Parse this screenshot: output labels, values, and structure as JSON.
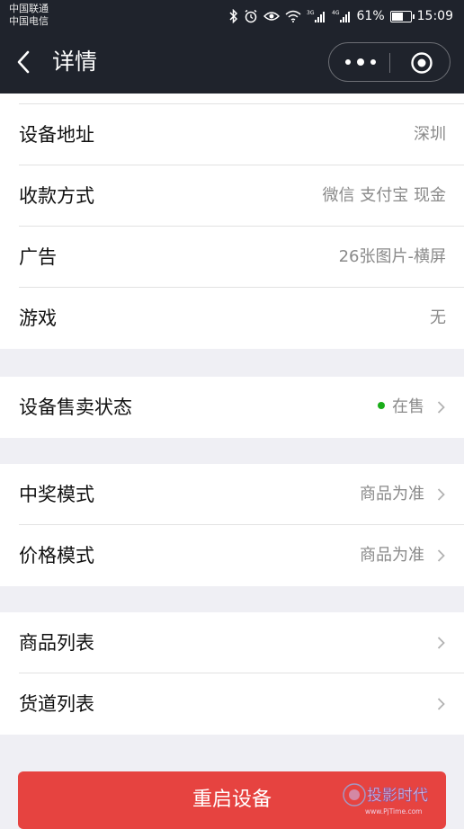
{
  "status_bar": {
    "carrier_1": "中国联通",
    "carrier_2": "中国电信",
    "battery": "61%",
    "time": "15:09",
    "icons": [
      "bluetooth-icon",
      "alarm-icon",
      "eye-icon",
      "wifi-icon",
      "signal-3g-icon",
      "signal-4g-icon",
      "battery-icon"
    ]
  },
  "header": {
    "title": "详情",
    "back_icon": "chevron-left-icon",
    "more_icon": "more-dots-icon",
    "close_icon": "target-circle-icon"
  },
  "info_rows": [
    {
      "label": "设备地址",
      "value": "深圳"
    },
    {
      "label": "收款方式",
      "value": "微信 支付宝 现金"
    },
    {
      "label": "广告",
      "value": "26张图片-横屏"
    },
    {
      "label": "游戏",
      "value": "无"
    }
  ],
  "sale_status": {
    "label": "设备售卖状态",
    "value": "在售",
    "dot_color": "#1aad19"
  },
  "mode_rows": [
    {
      "label": "中奖模式",
      "value": "商品为准"
    },
    {
      "label": "价格模式",
      "value": "商品为准"
    }
  ],
  "list_rows": [
    {
      "label": "商品列表"
    },
    {
      "label": "货道列表"
    }
  ],
  "restart_button": {
    "label": "重启设备",
    "color": "#e64340"
  },
  "watermark": {
    "text": "投影时代",
    "url_text": "www.PjTime.com"
  }
}
